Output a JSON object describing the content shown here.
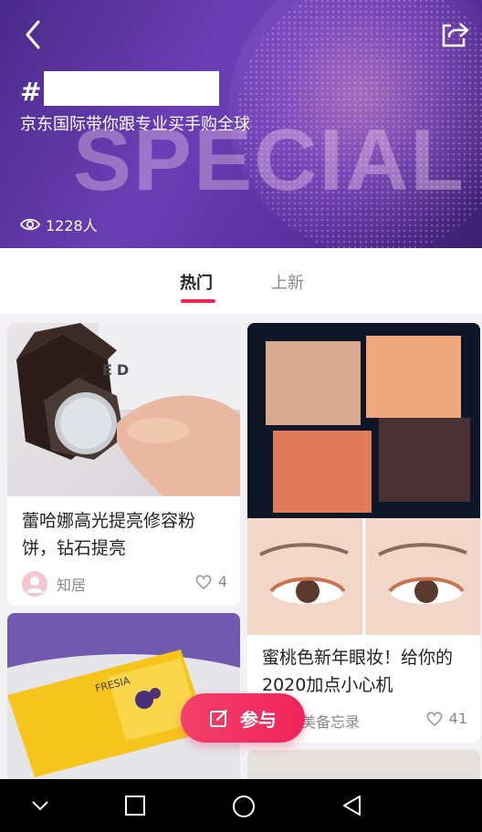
{
  "hero": {
    "hash": "#",
    "subtitle": "京东国际带你跟专业买手购全球",
    "watermark": "SPECIAL",
    "views": "1228人"
  },
  "tabs": [
    {
      "label": "热门",
      "active": true
    },
    {
      "label": "上新",
      "active": false
    }
  ],
  "cards": [
    {
      "title": "蕾哈娜高光提亮修容粉饼，钻石提亮",
      "author": "知居",
      "likes": "4",
      "image_text": "ED"
    },
    {
      "title": "蜜桃色新年眼妆！给你的2020加点小心机",
      "author": "V的变美备忘录",
      "likes": "41"
    },
    {
      "title": "",
      "image_text": "FRESIA"
    }
  ],
  "fab": {
    "label": "参与"
  },
  "colors": {
    "accent": "#f0244f",
    "hero": "#5a32a0"
  }
}
